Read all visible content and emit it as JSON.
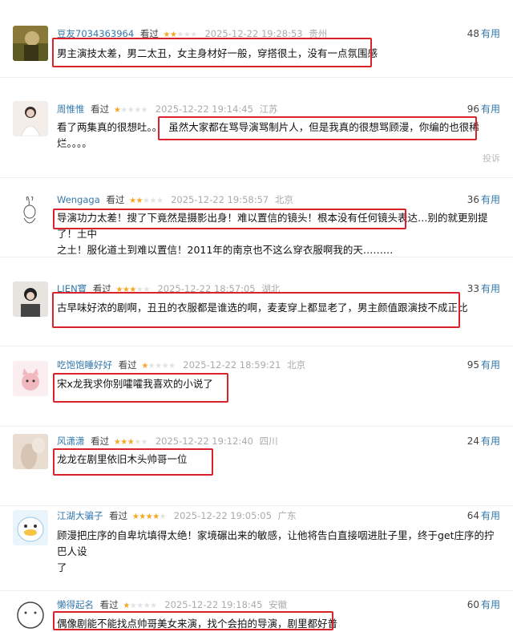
{
  "reviews": [
    {
      "username": "豆友7034363964",
      "watched": "看过",
      "stars": 2,
      "date": "2025-12-22 19:28:53",
      "location": "贵州",
      "votes": "48",
      "useful": "有用",
      "text": "男主演技太差，男二太丑，女主身材好一般，穿搭很土，没有一点氛围感",
      "avatar_icon": "landscape-avatar-icon"
    },
    {
      "username": "周惟惟",
      "watched": "看过",
      "stars": 1,
      "date": "2025-12-22 19:14:45",
      "location": "江苏",
      "votes": "96",
      "useful": "有用",
      "text_prefix": "看了两集真的很想吐。。",
      "text_highlight": "虽然大家都在骂导演骂制片人，但是我真的很想骂顾漫，你编的也很稀",
      "text_line2": "烂。。。。",
      "report": "投诉",
      "avatar_icon": "portrait-avatar-icon"
    },
    {
      "username": "Wengaga",
      "watched": "看过",
      "stars": 2,
      "date": "2025-12-22 19:58:57",
      "location": "北京",
      "votes": "36",
      "useful": "有用",
      "text_highlight": "导演功力太差！搜了下竟然是摄影出身！难以置信的镜头！根本没有任何镜头表达…",
      "text_rest": "别的就更别提了！土中",
      "text_line2": "之土！服化道土到难以置信！2011年的南京也不这么穿衣服啊我的天………",
      "avatar_icon": "rabbit-sketch-avatar-icon"
    },
    {
      "username": "LIEN寳",
      "watched": "看过",
      "stars": 3,
      "date": "2025-12-22 18:57:05",
      "location": "湖北",
      "votes": "33",
      "useful": "有用",
      "text": "古早味好浓的剧啊，丑丑的衣服都是谁选的啊，麦麦穿上都显老了，男主颜值跟演技不成正比",
      "avatar_icon": "woman-avatar-icon"
    },
    {
      "username": "吃饱饱睡好好",
      "watched": "看过",
      "stars": 1,
      "date": "2025-12-22 18:59:21",
      "location": "北京",
      "votes": "95",
      "useful": "有用",
      "text": "宋x龙我求你别嚯嚯我喜欢的小说了",
      "avatar_icon": "cat-avatar-icon"
    },
    {
      "username": "风潇潇",
      "watched": "看过",
      "stars": 3,
      "date": "2025-12-22 19:12:40",
      "location": "四川",
      "votes": "24",
      "useful": "有用",
      "text": "龙龙在剧里依旧木头帅哥一位",
      "avatar_icon": "blurry-avatar-icon"
    },
    {
      "username": "江湖大骗子",
      "watched": "看过",
      "stars": 4,
      "date": "2025-12-22 19:05:05",
      "location": "广东",
      "votes": "64",
      "useful": "有用",
      "text": "顾漫把庄序的自卑坑填得太绝！家境碾出来的敏感，让他将告白直接咽进肚子里，终于get庄序的拧巴人设",
      "text_line2": "了",
      "avatar_icon": "duck-avatar-icon"
    },
    {
      "username": "懒得起名",
      "watched": "看过",
      "stars": 1,
      "date": "2025-12-22 19:18:45",
      "location": "安徽",
      "votes": "60",
      "useful": "有用",
      "text": "偶像剧能不能找点帅哥美女来演，找个会拍的导演，剧里都好普",
      "avatar_icon": "cartoon-avatar-icon"
    }
  ]
}
